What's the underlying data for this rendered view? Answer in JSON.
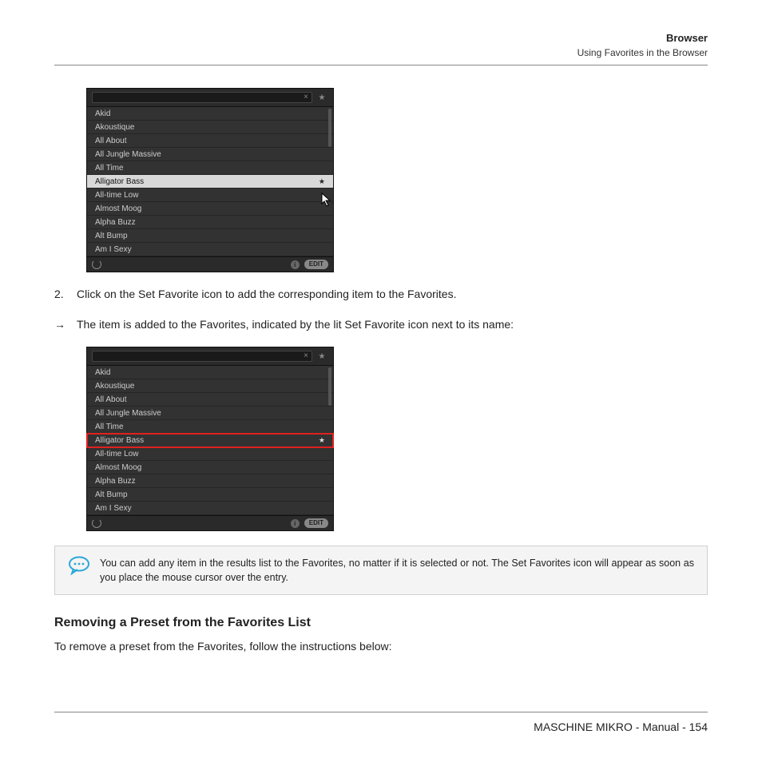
{
  "header": {
    "title": "Browser",
    "subtitle": "Using Favorites in the Browser"
  },
  "screenshot1": {
    "search_close": "×",
    "list": [
      "Akid",
      "Akoustique",
      "All About",
      "All Jungle Massive",
      "All Time",
      "Alligator Bass",
      "All-time Low",
      "Almost Moog",
      "Alpha Buzz",
      "Alt Bump",
      "Am I Sexy"
    ],
    "selected_index": 5,
    "selected_star": "★",
    "footer_info": "i",
    "footer_edit": "EDIT"
  },
  "step2": {
    "num": "2.",
    "text": "Click on the Set Favorite icon to add the corresponding item to the Favorites."
  },
  "result": {
    "arrow": "→",
    "text": "The item is added to the Favorites, indicated by the lit Set Favorite icon next to its name:"
  },
  "screenshot2": {
    "search_close": "×",
    "list": [
      "Akid",
      "Akoustique",
      "All About",
      "All Jungle Massive",
      "All Time",
      "Alligator Bass",
      "All-time Low",
      "Almost Moog",
      "Alpha Buzz",
      "Alt Bump",
      "Am I Sexy"
    ],
    "highlighted_index": 5,
    "highlighted_star": "★",
    "footer_info": "i",
    "footer_edit": "EDIT"
  },
  "tip": {
    "text": "You can add any item in the results list to the Favorites, no matter if it is selected or not. The Set Favorites icon will appear as soon as you place the mouse cursor over the entry."
  },
  "section": {
    "heading": "Removing a Preset from the Favorites List",
    "body": "To remove a preset from the Favorites, follow the instructions below:"
  },
  "footer": {
    "text": "MASCHINE MIKRO - Manual - 154"
  }
}
